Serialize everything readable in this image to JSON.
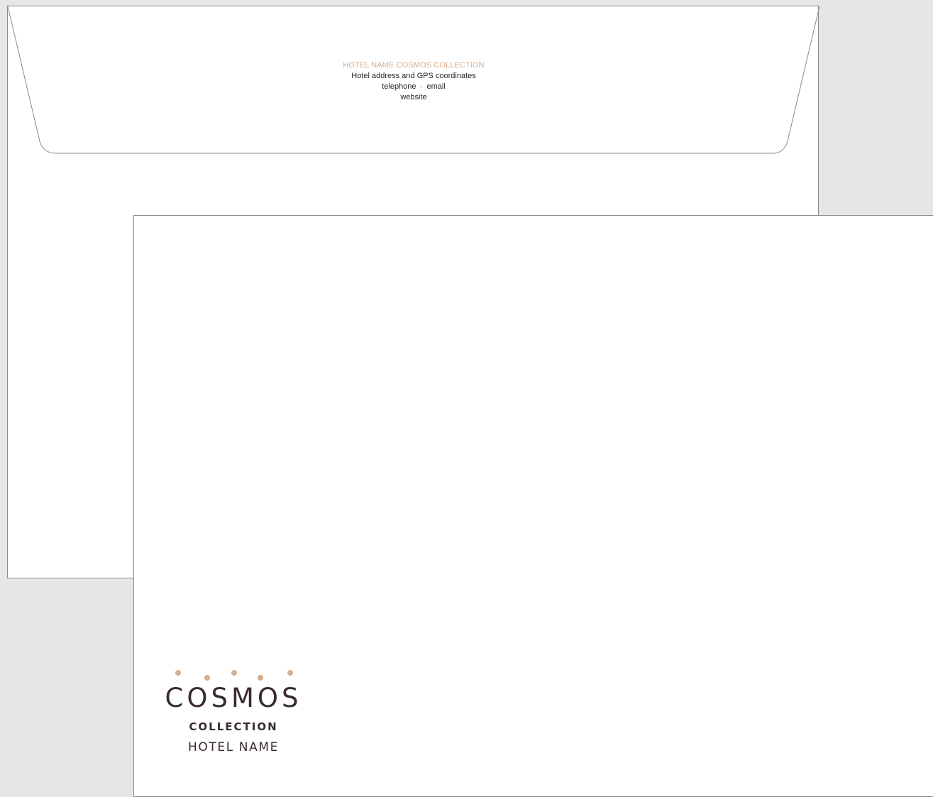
{
  "envelope_back": {
    "return_address": {
      "hotel_line": "HOTEL NAME COSMOS COLLECTION",
      "address_line": "Hotel address and GPS coordinates",
      "telephone": "telephone",
      "separator": "•",
      "email": "email",
      "website": "website"
    }
  },
  "envelope_front": {
    "logo": {
      "wordmark": "COSMOS",
      "collection": "COLLECTION",
      "hotel_name": "HOTEL NAME"
    }
  },
  "colors": {
    "background": "#e4e6e8",
    "paper": "#ffffff",
    "outline": "#8a8a8a",
    "accent": "#d6ad8e",
    "brand_dark": "#3a2b2f"
  }
}
